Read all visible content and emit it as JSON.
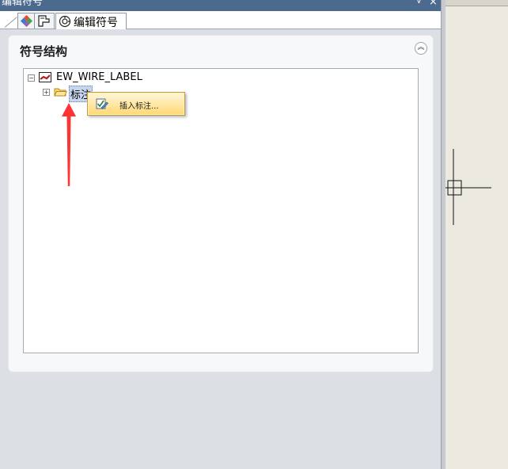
{
  "window": {
    "title": "编辑符号"
  },
  "tabs": [
    {
      "name": "palette",
      "icon": "color-diamond-icon",
      "label": ""
    },
    {
      "name": "properties",
      "icon": "sheet-flag-icon",
      "label": ""
    },
    {
      "name": "edit-symbol",
      "icon": "symbol-edit-icon",
      "label": "编辑符号"
    }
  ],
  "panel": {
    "title": "符号结构",
    "collapse_icon": "double-chevron-up-icon"
  },
  "tree": {
    "root": {
      "label": "EW_WIRE_LABEL",
      "icon": "wire-label-icon",
      "expanded": true
    },
    "children": [
      {
        "label": "标注",
        "icon": "folder-icon",
        "expanded": false,
        "selected": true
      }
    ]
  },
  "context_menu": {
    "items": [
      {
        "label": "插入标注...",
        "icon": "check-pencil-icon"
      }
    ]
  },
  "annotation": {
    "arrow_color": "#ff3333"
  },
  "colors": {
    "titlebar": "#4b6a8e",
    "menu_highlight": "#ffd978",
    "selection": "#c7d6ee"
  }
}
